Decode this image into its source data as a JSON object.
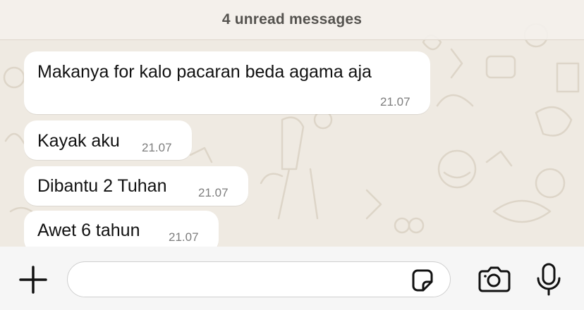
{
  "banner": {
    "text": "4 unread messages"
  },
  "messages": [
    {
      "text": "Makanya for kalo pacaran beda agama aja",
      "time": "21.07"
    },
    {
      "text": "Kayak aku",
      "time": "21.07"
    },
    {
      "text": "Dibantu 2 Tuhan",
      "time": "21.07"
    },
    {
      "text": "Awet 6 tahun",
      "time": "21.07"
    }
  ],
  "composer": {
    "input_value": "",
    "icons": [
      "plus-icon",
      "sticker-icon",
      "camera-icon",
      "microphone-icon"
    ]
  },
  "colors": {
    "background": "#efeae2",
    "bubble": "#ffffff",
    "timestamp": "#7d7d7d",
    "composer_bg": "#f6f6f6"
  }
}
